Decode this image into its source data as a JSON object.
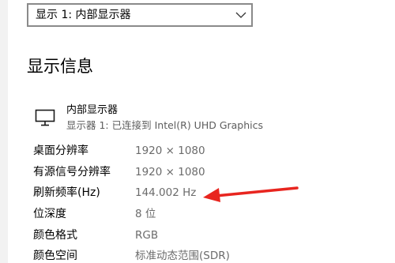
{
  "display_select": {
    "value": "显示 1: 内部显示器",
    "icon": "chevron-down-icon"
  },
  "section": {
    "title": "显示信息"
  },
  "display": {
    "icon": "monitor-icon",
    "name": "内部显示器",
    "subtitle": "显示器 1: 已连接到 Intel(R) UHD Graphics"
  },
  "info_rows": [
    {
      "label": "桌面分辨率",
      "value": "1920 × 1080"
    },
    {
      "label": "有源信号分辨率",
      "value": "1920 × 1080"
    },
    {
      "label": "刷新频率(Hz)",
      "value": "144.002 Hz"
    },
    {
      "label": "位深度",
      "value": "8 位"
    },
    {
      "label": "颜色格式",
      "value": "RGB"
    },
    {
      "label": "颜色空间",
      "value": "标准动态范围(SDR)"
    }
  ],
  "annotation": {
    "type": "arrow",
    "color": "#e8251f",
    "points_to": "刷新频率(Hz)"
  },
  "colors": {
    "label": "#000000",
    "value": "#6b6b6b",
    "subtitle": "#5d5d5d",
    "dropdown_border": "#8a8a8a"
  }
}
